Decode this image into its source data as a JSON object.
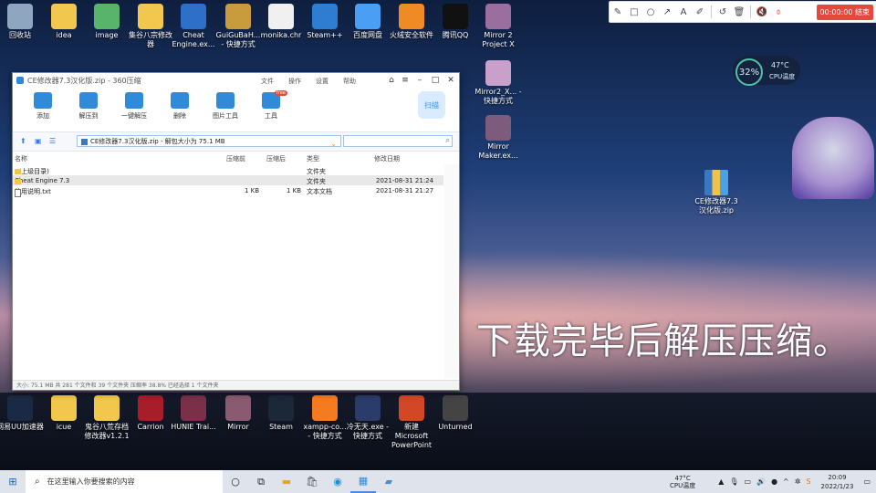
{
  "desktop": {
    "top_row": [
      {
        "label": "回收站",
        "color": "#8fa6c0"
      },
      {
        "label": "idea",
        "color": "#f1c84d"
      },
      {
        "label": "image",
        "color": "#58b36b"
      },
      {
        "label": "集谷八宗修改器",
        "color": "#f1c84d"
      },
      {
        "label": "Cheat Engine.ex...",
        "color": "#2e6fc7"
      },
      {
        "label": "GuiGuBaH... - 快捷方式",
        "color": "#c89b3c"
      },
      {
        "label": "monika.chr",
        "color": "#f0f0f0"
      },
      {
        "label": "Steam++",
        "color": "#2f7dd1"
      },
      {
        "label": "百度网盘",
        "color": "#4a9ff5"
      },
      {
        "label": "火绒安全软件",
        "color": "#f08a24"
      },
      {
        "label": "腾讯QQ",
        "color": "#111111"
      },
      {
        "label": "Mirror 2 Project X",
        "color": "#9a6fa0"
      }
    ],
    "right_col": [
      {
        "label": "Mirror2_X... - 快捷方式",
        "color": "#c9a0c9"
      },
      {
        "label": "Mirror Maker.ex...",
        "color": "#7d5b7d"
      }
    ],
    "bottom_row": [
      {
        "label": "网易UU加速器",
        "color": "#1a2a44"
      },
      {
        "label": "icue",
        "color": "#f1c84d"
      },
      {
        "label": "鬼谷八荒存档修改器v1.2.1",
        "color": "#f1c84d"
      },
      {
        "label": "Carrion",
        "color": "#a71d2a"
      },
      {
        "label": "HUNIE Trai...",
        "color": "#7a3048"
      },
      {
        "label": "Mirror",
        "color": "#8a5a70"
      },
      {
        "label": "Steam",
        "color": "#1b2838"
      },
      {
        "label": "xampp-co... - 快捷方式",
        "color": "#f47b20"
      },
      {
        "label": "冷无天.exe - 快捷方式",
        "color": "#2a3c6a"
      },
      {
        "label": "新建 Microsoft PowerPoint 演示文稿.pptx",
        "color": "#d24726"
      },
      {
        "label": "Unturned",
        "color": "#444444"
      }
    ],
    "zip_file": "CE修改器7.3汉化版.zip",
    "caption": "下载完毕后解压压缩。"
  },
  "recorder": {
    "tools": [
      "pen-icon",
      "rect-icon",
      "circle-icon",
      "arrow-icon",
      "marker-icon",
      "highlighter-icon",
      "undo-icon",
      "delete-icon",
      "mute-speaker-icon",
      "mute-mic-icon"
    ],
    "timer": "00:00:00 结束"
  },
  "cpu_widget": {
    "percent": "32%",
    "temp": "47°C",
    "label": "CPU温度"
  },
  "window": {
    "title": "CE修改器7.3汉化版.zip - 360压缩",
    "menus": [
      "文件",
      "操作",
      "设置",
      "帮助"
    ],
    "toolbar": [
      {
        "label": "添加",
        "icon": "add-icon"
      },
      {
        "label": "解压到",
        "icon": "extract-icon"
      },
      {
        "label": "一键解压",
        "icon": "oneclick-extract-icon"
      },
      {
        "label": "删除",
        "icon": "delete-icon"
      },
      {
        "label": "图片工具",
        "icon": "image-tool-icon"
      },
      {
        "label": "工具",
        "icon": "tools-icon"
      }
    ],
    "tools_badge": "free",
    "scan_label": "扫描",
    "path": "CE修改器7.3汉化版.zip - 解包大小为 75.1 MB",
    "columns": [
      "名称",
      "压缩前",
      "压缩后",
      "类型",
      "修改日期"
    ],
    "rows": [
      {
        "name": "..(上级目录)",
        "before": "",
        "after": "",
        "type": "文件夹",
        "date": "",
        "kind": "folder"
      },
      {
        "name": "Cheat Engine 7.3",
        "before": "",
        "after": "",
        "type": "文件夹",
        "date": "2021-08-31 21:24",
        "kind": "folder"
      },
      {
        "name": "使用说明.txt",
        "before": "1 KB",
        "after": "1 KB",
        "type": "文本文档",
        "date": "2021-08-31 21:27",
        "kind": "doc"
      }
    ],
    "status": "大小: 75.1 MB 共 281 个文件和 39 个文件夹 压缩率 38.8% 已经选择 1 个文件夹"
  },
  "taskbar": {
    "search_placeholder": "在这里输入你要搜索的内容",
    "apps": [
      "task-view-icon",
      "cortana-icon",
      "file-explorer-icon",
      "store-icon",
      "edge-icon",
      "360zip-icon",
      "notebook-icon"
    ],
    "cpu_temp": "47°C",
    "cpu_label": "CPU温度",
    "time": "20:09",
    "date": "2022/1/23"
  }
}
